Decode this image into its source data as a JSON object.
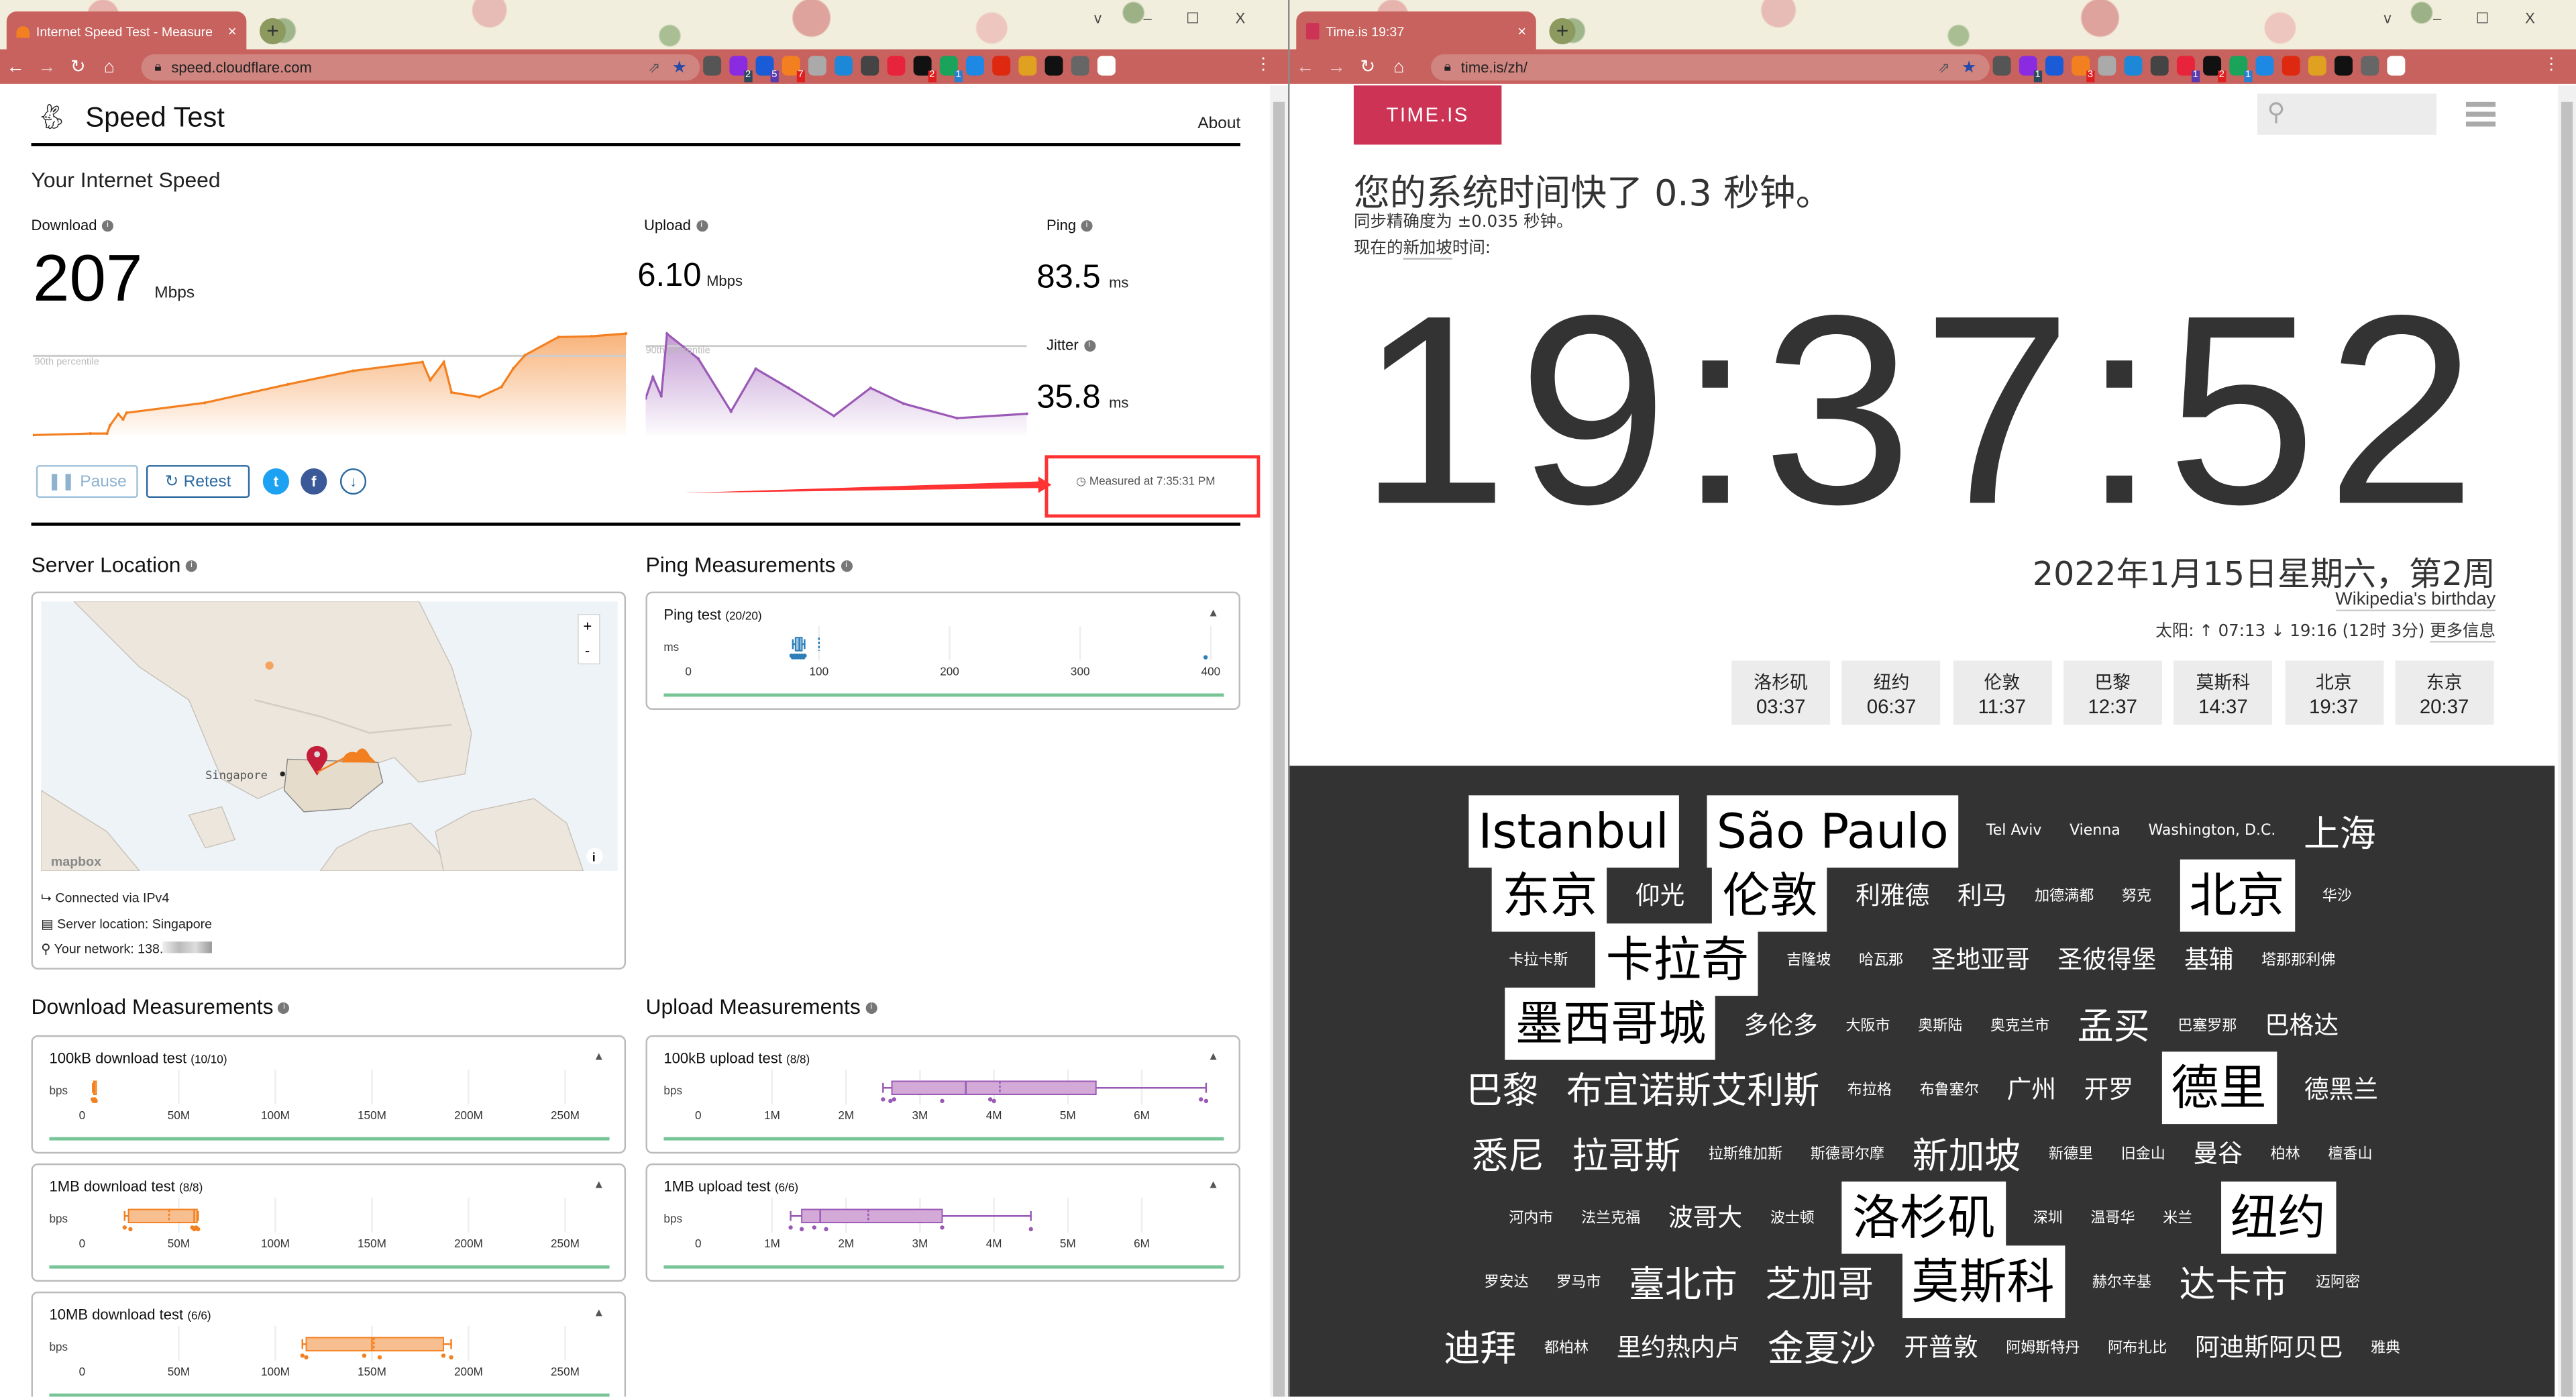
{
  "left_browser": {
    "tab_title": "Internet Speed Test - Measure",
    "url": "speed.cloudflare.com",
    "extension_badges": [
      "",
      "2",
      "5",
      "7",
      "",
      "",
      "",
      "",
      "2",
      "1",
      "",
      "",
      "",
      "",
      "",
      ""
    ],
    "window_controls": [
      "v",
      "–",
      "☐",
      "X"
    ]
  },
  "right_browser": {
    "tab_title": "Time.is 19:37",
    "url": "time.is/zh/",
    "extension_badges": [
      "",
      "1",
      "",
      "3",
      "",
      "",
      "",
      "1",
      "2",
      "1",
      "",
      "",
      "",
      "",
      "",
      ""
    ],
    "window_controls": [
      "v",
      "–",
      "☐",
      "X"
    ]
  },
  "speedtest": {
    "brand": "Speed Test",
    "about": "About",
    "section_title": "Your Internet Speed",
    "download": {
      "label": "Download",
      "value": "207",
      "unit": "Mbps"
    },
    "upload": {
      "label": "Upload",
      "value": "6.10",
      "unit": "Mbps"
    },
    "ping": {
      "label": "Ping",
      "value": "83.5",
      "unit": "ms"
    },
    "jitter": {
      "label": "Jitter",
      "value": "35.8",
      "unit": "ms"
    },
    "percentile_label": "90th percentile",
    "download_graph": {
      "color": "#f38020",
      "percentile_mbps": 207,
      "points_t_pct_mbps": [
        [
          0,
          1
        ],
        [
          9.7,
          5
        ],
        [
          12.5,
          5
        ],
        [
          13,
          26
        ],
        [
          14.4,
          56
        ],
        [
          15.2,
          42
        ],
        [
          15.8,
          59
        ],
        [
          29,
          85
        ],
        [
          43,
          133
        ],
        [
          54,
          168
        ],
        [
          65.7,
          191
        ],
        [
          67,
          144
        ],
        [
          69.3,
          191
        ],
        [
          70.6,
          112
        ],
        [
          75.3,
          100
        ],
        [
          79,
          126
        ],
        [
          81,
          174
        ],
        [
          83,
          209
        ],
        [
          88.6,
          256
        ],
        [
          94.2,
          258
        ],
        [
          100,
          265
        ]
      ],
      "max_mbps": 265
    },
    "upload_graph": {
      "color": "#9b59b6",
      "percentile_mbps": 6.1,
      "points_t_pct_mbps": [
        [
          0,
          2.53
        ],
        [
          1.9,
          3.99
        ],
        [
          4.1,
          2.68
        ],
        [
          5.6,
          6.94
        ],
        [
          13.8,
          5.24
        ],
        [
          22.4,
          1.64
        ],
        [
          28.9,
          4.55
        ],
        [
          37.5,
          3.24
        ],
        [
          49.4,
          1.33
        ],
        [
          59,
          3.24
        ],
        [
          67.7,
          2.17
        ],
        [
          81.7,
          1.18
        ],
        [
          100,
          1.48
        ]
      ],
      "max_mbps": 6.95
    },
    "buttons": {
      "pause": "Pause",
      "retest": "Retest"
    },
    "measured_at": "Measured at 7:35:31 PM",
    "server_location": {
      "title": "Server Location",
      "map_label": "Singapore",
      "attribution": "mapbox",
      "zoom_in": "+",
      "zoom_out": "-",
      "connected": "Connected via IPv4",
      "server": "Server location: Singapore",
      "network": "Your network: 138."
    },
    "ping_measurements": {
      "title": "Ping Measurements",
      "tests": [
        {
          "name": "Ping test",
          "count": "(20/20)",
          "unit": "ms",
          "ticks": [
            "0",
            "100",
            "200",
            "300",
            "400"
          ],
          "tick_values": [
            0,
            100,
            200,
            300,
            400
          ],
          "axis_max": 410,
          "color": "#2e7fb8",
          "fill": "#9fc3e0",
          "box": {
            "min": 80,
            "q1": 82,
            "median": 85,
            "mean": 100,
            "q3": 87,
            "max": 89
          },
          "points": [
            79,
            80,
            81,
            82,
            83,
            84,
            85,
            86,
            87,
            88,
            89,
            396
          ]
        }
      ]
    },
    "download_measurements": {
      "title": "Download Measurements",
      "tests": [
        {
          "name": "100kB download test",
          "count": "(10/10)",
          "unit": "bps",
          "ticks": [
            "0",
            "50M",
            "100M",
            "150M",
            "200M",
            "250M"
          ],
          "tick_values": [
            0,
            50,
            100,
            150,
            200,
            250
          ],
          "axis_max": 275,
          "color": "#f38020",
          "fill": "#f7bf8f",
          "box": {
            "min": 5.5,
            "q1": 6,
            "median": 6.3,
            "mean": 6.4,
            "q3": 6.6,
            "max": 7
          },
          "points": [
            5.5,
            6,
            6.5,
            7
          ]
        },
        {
          "name": "1MB download test",
          "count": "(8/8)",
          "unit": "bps",
          "ticks": [
            "0",
            "50M",
            "100M",
            "150M",
            "200M",
            "250M"
          ],
          "tick_values": [
            0,
            50,
            100,
            150,
            200,
            250
          ],
          "axis_max": 275,
          "color": "#f38020",
          "fill": "#f7bf8f",
          "box": {
            "min": 22,
            "q1": 24,
            "median": 58,
            "mean": 45,
            "q3": 59.5,
            "max": 60
          },
          "points": [
            22,
            25,
            57,
            58,
            59,
            60
          ]
        },
        {
          "name": "10MB download test",
          "count": "(6/6)",
          "unit": "bps",
          "ticks": [
            "0",
            "50M",
            "100M",
            "150M",
            "200M",
            "250M"
          ],
          "tick_values": [
            0,
            50,
            100,
            150,
            200,
            250
          ],
          "axis_max": 275,
          "color": "#f38020",
          "fill": "#f7bf8f",
          "box": {
            "min": 114,
            "q1": 116,
            "median": 150,
            "mean": 151,
            "q3": 187,
            "max": 191
          },
          "points": [
            114,
            116,
            146,
            154,
            187,
            191
          ]
        }
      ]
    },
    "upload_measurements": {
      "title": "Upload Measurements",
      "tests": [
        {
          "name": "100kB upload test",
          "count": "(8/8)",
          "unit": "bps",
          "ticks": [
            "0",
            "1M",
            "2M",
            "3M",
            "4M",
            "5M",
            "6M"
          ],
          "tick_values": [
            0,
            1,
            2,
            3,
            4,
            5,
            6
          ],
          "axis_max": 7,
          "color": "#9b59b6",
          "fill": "#d3a9d8",
          "box": {
            "min": 2.5,
            "q1": 2.62,
            "median": 3.62,
            "mean": 4.08,
            "q3": 5.38,
            "max": 6.87
          },
          "points": [
            2.5,
            2.6,
            2.65,
            3.3,
            3.95,
            4.0,
            6.8,
            6.87
          ]
        },
        {
          "name": "1MB upload test",
          "count": "(6/6)",
          "unit": "bps",
          "ticks": [
            "0",
            "1M",
            "2M",
            "3M",
            "4M",
            "5M",
            "6M"
          ],
          "tick_values": [
            0,
            1,
            2,
            3,
            4,
            5,
            6
          ],
          "axis_max": 7,
          "color": "#9b59b6",
          "fill": "#d3a9d8",
          "box": {
            "min": 1.25,
            "q1": 1.4,
            "median": 1.65,
            "mean": 2.3,
            "q3": 3.3,
            "max": 4.5
          },
          "points": [
            1.25,
            1.4,
            1.57,
            1.73,
            3.3,
            4.5
          ]
        }
      ]
    }
  },
  "timeis": {
    "logo": "TIME.IS",
    "brand_color": "#cc3355",
    "headline": "您的系统时间快了 0.3 秒钟。",
    "accuracy": "同步精确度为 ±0.035 秒钟。",
    "now_label_prefix": "现在的",
    "now_label_city": "新加坡",
    "now_label_suffix": "时间:",
    "clock": "19:37:52",
    "date": "2022年1月15日星期六，第2周",
    "holiday": "Wikipedia's birthday",
    "sun": "太阳: ↑ 07:13 ↓ 19:16 (12时 3分)",
    "more_info": "更多信息",
    "city_clocks": [
      {
        "city": "洛杉矶",
        "time": "03:37"
      },
      {
        "city": "纽约",
        "time": "06:37"
      },
      {
        "city": "伦敦",
        "time": "11:37"
      },
      {
        "city": "巴黎",
        "time": "12:37"
      },
      {
        "city": "莫斯科",
        "time": "14:37"
      },
      {
        "city": "北京",
        "time": "19:37"
      },
      {
        "city": "东京",
        "time": "20:37"
      }
    ],
    "city_cloud_rows": [
      [
        [
          "Istanbul",
          "xl"
        ],
        [
          "São Paulo",
          "xl"
        ],
        [
          "Tel Aviv",
          "s"
        ],
        [
          "Vienna",
          "s"
        ],
        [
          "Washington, D.C.",
          "s"
        ],
        [
          "上海",
          "l"
        ]
      ],
      [
        [
          "东京",
          "xl"
        ],
        [
          "仰光",
          "m"
        ],
        [
          "伦敦",
          "xl"
        ],
        [
          "利雅德",
          "m"
        ],
        [
          "利马",
          "m"
        ],
        [
          "加德满都",
          "s"
        ],
        [
          "努克",
          "s"
        ],
        [
          "北京",
          "xl"
        ],
        [
          "华沙",
          "s"
        ]
      ],
      [
        [
          "卡拉卡斯",
          "s"
        ],
        [
          "卡拉奇",
          "xl"
        ],
        [
          "吉隆坡",
          "s"
        ],
        [
          "哈瓦那",
          "s"
        ],
        [
          "圣地亚哥",
          "m"
        ],
        [
          "圣彼得堡",
          "m"
        ],
        [
          "基辅",
          "m"
        ],
        [
          "塔那那利佛",
          "s"
        ]
      ],
      [
        [
          "墨西哥城",
          "xl"
        ],
        [
          "多伦多",
          "m"
        ],
        [
          "大阪市",
          "s"
        ],
        [
          "奥斯陆",
          "s"
        ],
        [
          "奥克兰市",
          "s"
        ],
        [
          "孟买",
          "l"
        ],
        [
          "巴塞罗那",
          "s"
        ],
        [
          "巴格达",
          "m"
        ]
      ],
      [
        [
          "巴黎",
          "l"
        ],
        [
          "布宜诺斯艾利斯",
          "l"
        ],
        [
          "布拉格",
          "s"
        ],
        [
          "布鲁塞尔",
          "s"
        ],
        [
          "广州",
          "m"
        ],
        [
          "开罗",
          "m"
        ],
        [
          "德里",
          "xl"
        ],
        [
          "德黑兰",
          "m"
        ]
      ],
      [
        [
          "悉尼",
          "l"
        ],
        [
          "拉哥斯",
          "l"
        ],
        [
          "拉斯维加斯",
          "s"
        ],
        [
          "斯德哥尔摩",
          "s"
        ],
        [
          "新加坡",
          "l"
        ],
        [
          "新德里",
          "s"
        ],
        [
          "旧金山",
          "s"
        ],
        [
          "曼谷",
          "m"
        ],
        [
          "柏林",
          "s"
        ],
        [
          "檀香山",
          "s"
        ]
      ],
      [
        [
          "河内市",
          "s"
        ],
        [
          "法兰克福",
          "s"
        ],
        [
          "波哥大",
          "m"
        ],
        [
          "波士顿",
          "s"
        ],
        [
          "洛杉矶",
          "xl"
        ],
        [
          "深圳",
          "s"
        ],
        [
          "温哥华",
          "s"
        ],
        [
          "米兰",
          "s"
        ],
        [
          "纽约",
          "xl"
        ]
      ],
      [
        [
          "罗安达",
          "s"
        ],
        [
          "罗马市",
          "s"
        ],
        [
          "臺北市",
          "l"
        ],
        [
          "芝加哥",
          "l"
        ],
        [
          "莫斯科",
          "xl"
        ],
        [
          "赫尔辛基",
          "s"
        ],
        [
          "达卡市",
          "l"
        ],
        [
          "迈阿密",
          "s"
        ]
      ],
      [
        [
          "迪拜",
          "l"
        ],
        [
          "都柏林",
          "s"
        ],
        [
          "里约热内卢",
          "m"
        ],
        [
          "金夏沙",
          "l"
        ],
        [
          "开普敦",
          "m"
        ],
        [
          "阿姆斯特丹",
          "s"
        ],
        [
          "阿布扎比",
          "s"
        ],
        [
          "阿迪斯阿贝巴",
          "m"
        ],
        [
          "雅典",
          "s"
        ]
      ]
    ]
  }
}
